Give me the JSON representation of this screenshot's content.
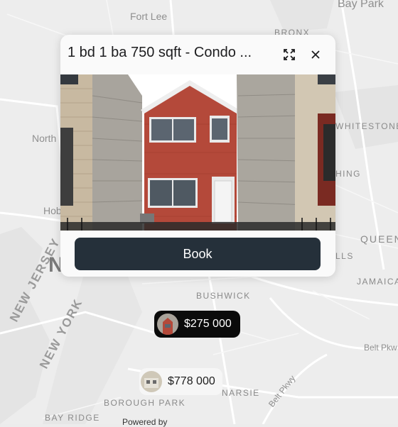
{
  "map": {
    "labels": {
      "fort_lee": "Fort Lee",
      "bay_park": "Bay Park",
      "bronx": "BRONX",
      "whitestone": "WHITESTONE",
      "north": "North",
      "hing": "HING",
      "hob": "Hob",
      "queens": "QUEEN",
      "lls": "LLS",
      "jamaica": "JAMAICA",
      "bushwick": "BUSHWICK",
      "new_jersey": "NEW JERSEY",
      "new_york": "NEW YORK",
      "belt_pkwy_east": "Belt Pkw",
      "belt_pkwy_south": "Belt Pkwy",
      "canarsie": "NARSIE",
      "borough_park": "BOROUGH PARK",
      "bay_ridge": "BAY RIDGE",
      "big_n": "N"
    },
    "powered_by": "Powered by"
  },
  "popup": {
    "title": "1 bd 1 ba 750 sqft - Condo ...",
    "expand_icon": "expand-icon",
    "close_icon": "close-icon",
    "book_label": "Book"
  },
  "markers": [
    {
      "price": "$275 000",
      "style": "dark"
    },
    {
      "price": "$778 000",
      "style": "light"
    }
  ],
  "colors": {
    "button": "#25303a",
    "marker_dark": "#0b0b0b",
    "brick": "#b4493a",
    "siding": "#a9a39a"
  }
}
